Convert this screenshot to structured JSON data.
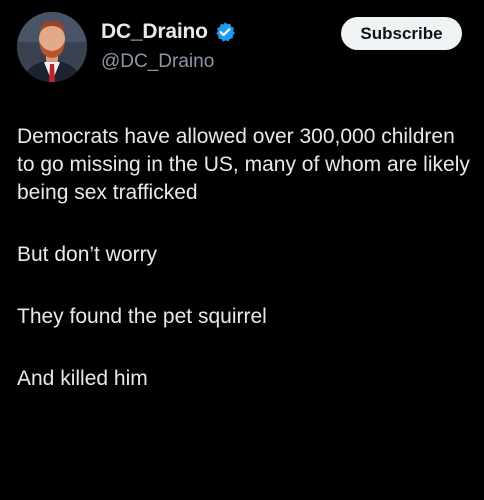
{
  "author": {
    "display_name": "DC_Draino",
    "handle": "@DC_Draino",
    "verified": true
  },
  "actions": {
    "subscribe_label": "Subscribe"
  },
  "tweet": {
    "paragraphs": [
      "Democrats have allowed over 300,000 children to go missing in the US, many of whom are likely being sex trafficked",
      "But don’t worry",
      "They found the pet squirrel",
      "And killed him"
    ]
  },
  "icons": {
    "verified": "verified-badge-icon",
    "avatar": "profile-avatar"
  },
  "colors": {
    "background": "#000000",
    "text_primary": "#e7e9ea",
    "text_secondary": "#8b98a5",
    "verified_blue": "#1d9bf0",
    "button_bg": "#eff3f4",
    "button_text": "#0f1419"
  }
}
